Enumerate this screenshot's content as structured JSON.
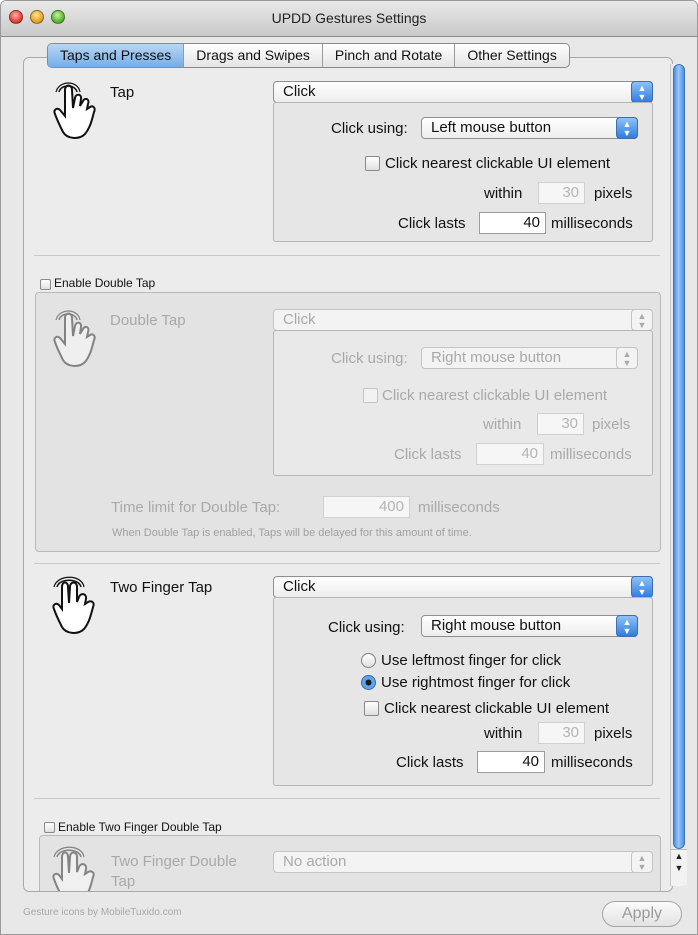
{
  "window": {
    "title": "UPDD Gestures Settings"
  },
  "tabs": [
    {
      "label": "Taps and Presses",
      "active": true
    },
    {
      "label": "Drags and Swipes",
      "active": false
    },
    {
      "label": "Pinch and Rotate",
      "active": false
    },
    {
      "label": "Other Settings",
      "active": false
    }
  ],
  "tap": {
    "label": "Tap",
    "action": "Click",
    "click_using_label": "Click using:",
    "click_using": "Left mouse button",
    "nearest_label": "Click nearest clickable UI element",
    "within_label": "within",
    "within_value": "30",
    "pixels_label": "pixels",
    "lasts_label": "Click lasts",
    "lasts_value": "40",
    "ms_label": "milliseconds"
  },
  "double_tap": {
    "enable_label": "Enable Double Tap",
    "label": "Double Tap",
    "action": "Click",
    "click_using_label": "Click using:",
    "click_using": "Right mouse button",
    "nearest_label": "Click nearest clickable UI element",
    "within_label": "within",
    "within_value": "30",
    "pixels_label": "pixels",
    "lasts_label": "Click lasts",
    "lasts_value": "40",
    "ms_label": "milliseconds",
    "time_limit_label": "Time limit for Double Tap:",
    "time_limit_value": "400",
    "time_limit_unit": "milliseconds",
    "note": "When Double Tap is enabled, Taps will be delayed for this amount of time."
  },
  "two_finger_tap": {
    "label": "Two Finger Tap",
    "action": "Click",
    "click_using_label": "Click using:",
    "click_using": "Right mouse button",
    "leftmost_label": "Use leftmost finger for click",
    "rightmost_label": "Use rightmost finger for click",
    "nearest_label": "Click nearest clickable UI element",
    "within_label": "within",
    "within_value": "30",
    "pixels_label": "pixels",
    "lasts_label": "Click lasts",
    "lasts_value": "40",
    "ms_label": "milliseconds"
  },
  "two_finger_double": {
    "enable_label": "Enable Two Finger Double Tap",
    "label_line1": "Two Finger Double",
    "label_line2": "Tap",
    "action": "No action"
  },
  "footer": {
    "credit": "Gesture icons by MobileTuxido.com",
    "apply_label": "Apply"
  }
}
